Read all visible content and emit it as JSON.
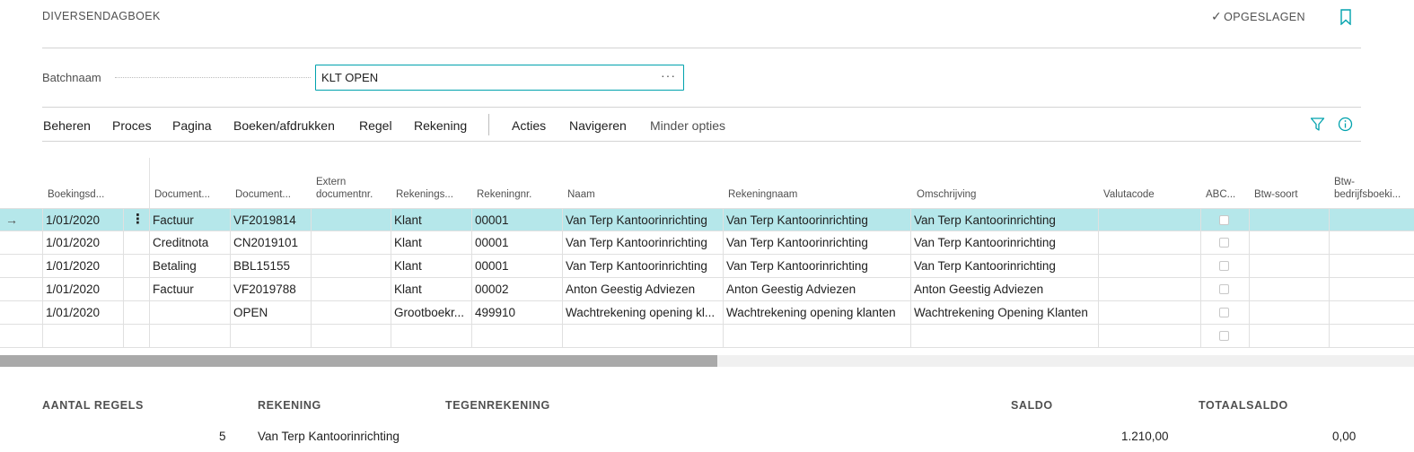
{
  "header": {
    "title": "DIVERSENDAGBOEK",
    "saved_label": "OPGESLAGEN"
  },
  "batch": {
    "label": "Batchnaam",
    "value": "KLT OPEN"
  },
  "actions": [
    "Beheren",
    "Proces",
    "Pagina",
    "Boeken/afdrukken",
    "Regel",
    "Rekening",
    "Acties",
    "Navigeren",
    "Minder opties"
  ],
  "columns": [
    "Boekingsd...",
    "Document...",
    "Document...",
    "Extern documentnr.",
    "Rekenings...",
    "Rekeningnr.",
    "Naam",
    "Rekeningnaam",
    "Omschrijving",
    "Valutacode",
    "ABC...",
    "Btw-soort",
    "Btw-bedrijfsboeki..."
  ],
  "rows": [
    {
      "date": "1/01/2020",
      "doc_type": "Factuur",
      "doc_no": "VF2019814",
      "ext_doc": "",
      "acc_type": "Klant",
      "acc_no": "00001",
      "name": "Van Terp Kantoorinrichting",
      "acc_name": "Van Terp Kantoorinrichting",
      "description": "Van Terp Kantoorinrichting"
    },
    {
      "date": "1/01/2020",
      "doc_type": "Creditnota",
      "doc_no": "CN2019101",
      "ext_doc": "",
      "acc_type": "Klant",
      "acc_no": "00001",
      "name": "Van Terp Kantoorinrichting",
      "acc_name": "Van Terp Kantoorinrichting",
      "description": "Van Terp Kantoorinrichting"
    },
    {
      "date": "1/01/2020",
      "doc_type": "Betaling",
      "doc_no": "BBL15155",
      "ext_doc": "",
      "acc_type": "Klant",
      "acc_no": "00001",
      "name": "Van Terp Kantoorinrichting",
      "acc_name": "Van Terp Kantoorinrichting",
      "description": "Van Terp Kantoorinrichting"
    },
    {
      "date": "1/01/2020",
      "doc_type": "Factuur",
      "doc_no": "VF2019788",
      "ext_doc": "",
      "acc_type": "Klant",
      "acc_no": "00002",
      "name": "Anton Geestig Adviezen",
      "acc_name": "Anton Geestig Adviezen",
      "description": "Anton Geestig Adviezen"
    },
    {
      "date": "1/01/2020",
      "doc_type": "",
      "doc_no": "OPEN",
      "ext_doc": "",
      "acc_type": "Grootboekr...",
      "acc_no": "499910",
      "name": "Wachtrekening opening kl...",
      "acc_name": "Wachtrekening opening klanten",
      "description": "Wachtrekening Opening Klanten"
    },
    {
      "date": "",
      "doc_type": "",
      "doc_no": "",
      "ext_doc": "",
      "acc_type": "",
      "acc_no": "",
      "name": "",
      "acc_name": "",
      "description": ""
    }
  ],
  "footer": {
    "labels": [
      "AANTAL REGELS",
      "REKENING",
      "TEGENREKENING",
      "SALDO",
      "TOTAALSALDO"
    ],
    "count": "5",
    "account": "Van Terp Kantoorinrichting",
    "balance": "1.210,00",
    "total_balance": "0,00"
  }
}
